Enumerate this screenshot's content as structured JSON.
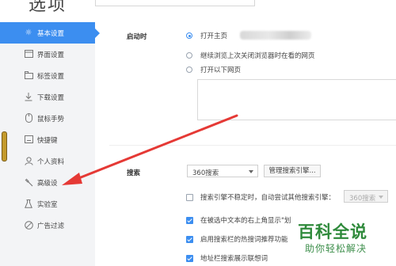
{
  "window": {
    "title": "选项"
  },
  "sidebar": {
    "items": [
      {
        "label": "基本设置",
        "icon": "gear-icon",
        "active": true
      },
      {
        "label": "界面设置",
        "icon": "window-icon",
        "active": false
      },
      {
        "label": "标签设置",
        "icon": "tabs-icon",
        "active": false
      },
      {
        "label": "下载设置",
        "icon": "download-icon",
        "active": false
      },
      {
        "label": "鼠标手势",
        "icon": "mouse-icon",
        "active": false
      },
      {
        "label": "快捷键",
        "icon": "keyboard-icon",
        "active": false
      },
      {
        "label": "个人资料",
        "icon": "person-icon",
        "active": false
      },
      {
        "label": "高级设",
        "icon": "wrench-icon",
        "active": false
      },
      {
        "label": "实验室",
        "icon": "flask-icon",
        "active": false
      },
      {
        "label": "广告过滤",
        "icon": "block-icon",
        "active": false
      }
    ]
  },
  "startup": {
    "label": "启动时",
    "options": [
      {
        "label": "打开主页",
        "selected": true
      },
      {
        "label": "继续浏览上次关闭浏览器时在看的网页",
        "selected": false
      },
      {
        "label": "打开以下网页",
        "selected": false
      }
    ]
  },
  "search": {
    "label": "搜索",
    "engine": "360搜索",
    "manage_button": "管理搜索引擎...",
    "fallback_text": "搜索引擎不稳定时，自动尝试其他搜索引擎：",
    "fallback_engine": "360搜索",
    "fallback_checked": false,
    "options": [
      {
        "label": "在被选中文本的右上角显示\"划",
        "checked": true
      },
      {
        "label": "启用搜索栏的热搜词推荐功能",
        "checked": true
      },
      {
        "label": "地址栏搜索展示联想词",
        "checked": true
      }
    ]
  },
  "watermark": {
    "title": "百科全说",
    "subtitle": "助你轻松解决"
  },
  "colors": {
    "accent": "#3c8ef0",
    "annotation_arrow": "#e53935",
    "watermark": "#2f8a3b"
  }
}
